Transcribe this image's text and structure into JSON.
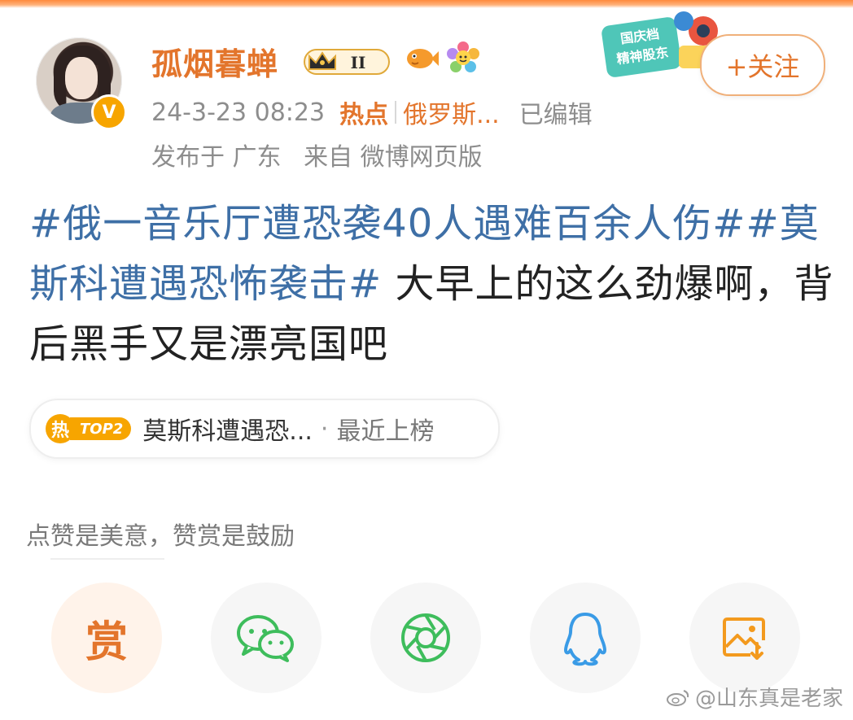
{
  "post": {
    "username": "孤烟暮蝉",
    "level_badge": "II",
    "timestamp": "24-3-23 08:23",
    "hot_label": "热点",
    "hot_topic": "俄罗斯...",
    "edited": "已编辑",
    "location": "发布于 广东",
    "source": "来自 微博网页版",
    "follow_label": "+关注",
    "verified_mark": "V",
    "content": {
      "tag1": "#俄一音乐厅遭恐袭40人遇难百余人伤#",
      "tag2": "#莫斯科遭遇恐怖袭击#",
      "text": " 大早上的这么劲爆啊，背后黑手又是漂亮国吧"
    },
    "topic_card": {
      "hot_char": "热",
      "rank": "TOP2",
      "title": "莫斯科遭遇恐...",
      "separator": "·",
      "status": "最近上榜"
    },
    "promo_lines": [
      "国庆档",
      "精神股东"
    ]
  },
  "reward": {
    "prompt": "点赞是美意，赞赏是鼓励",
    "button_label": "赏"
  },
  "share_targets": [
    {
      "name": "reward",
      "icon": "reward-icon"
    },
    {
      "name": "wechat",
      "icon": "wechat-icon"
    },
    {
      "name": "moments",
      "icon": "moments-icon"
    },
    {
      "name": "qq",
      "icon": "qq-icon"
    },
    {
      "name": "save-image",
      "icon": "save-image-icon"
    }
  ],
  "watermark": "@山东真是老家",
  "colors": {
    "accent": "#e3752c",
    "hashtag": "#3e6fa6",
    "meta": "#8d8d8d",
    "wechat_green": "#3ebd5c",
    "qq_blue": "#3a9be6"
  }
}
